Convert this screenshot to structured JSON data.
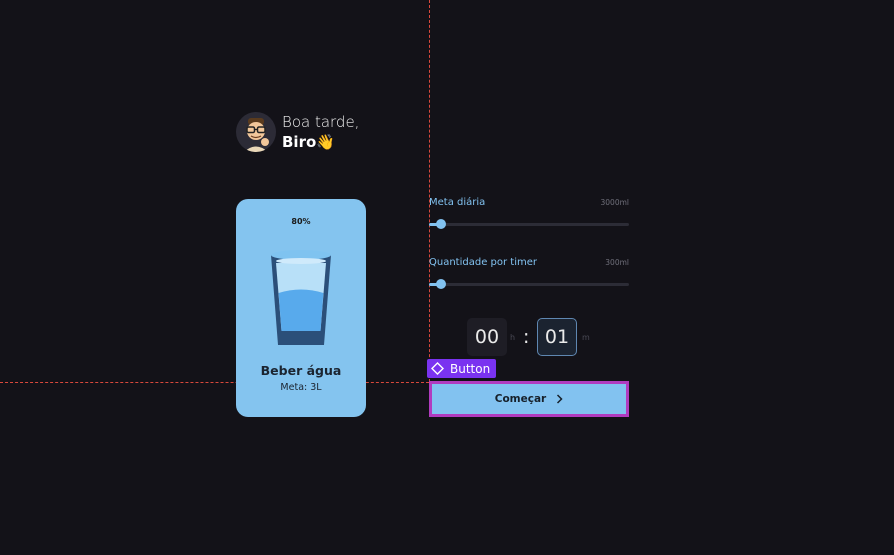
{
  "greeting": {
    "line1": "Boa tarde,",
    "name": "Biro",
    "emoji": "👋",
    "avatar_icon": "emoji-avatar-nerd"
  },
  "card": {
    "percent": "80%",
    "fill_level": 0.8,
    "title": "Beber água",
    "meta": "Meta: 3L",
    "icon": "water-glass-icon",
    "background": "#84c4ef"
  },
  "sliders": {
    "daily": {
      "label": "Meta diária",
      "max_label": "3000ml",
      "value_fraction": 0.06
    },
    "per_timer": {
      "label": "Quantidade por timer",
      "max_label": "300ml",
      "value_fraction": 0.06
    }
  },
  "timer": {
    "hours": "00",
    "hours_unit": "h",
    "separator": ":",
    "minutes": "01",
    "minutes_unit": "m"
  },
  "inspector": {
    "badge_label": "Button",
    "badge_color": "#7a33f0",
    "selection_color": "#b13bbf",
    "guide_color": "#d9483b"
  },
  "cta": {
    "label": "Começar",
    "icon": "chevron-right-icon",
    "background": "#82c2f0"
  },
  "colors": {
    "background": "#131218",
    "accent": "#82c2f0"
  }
}
